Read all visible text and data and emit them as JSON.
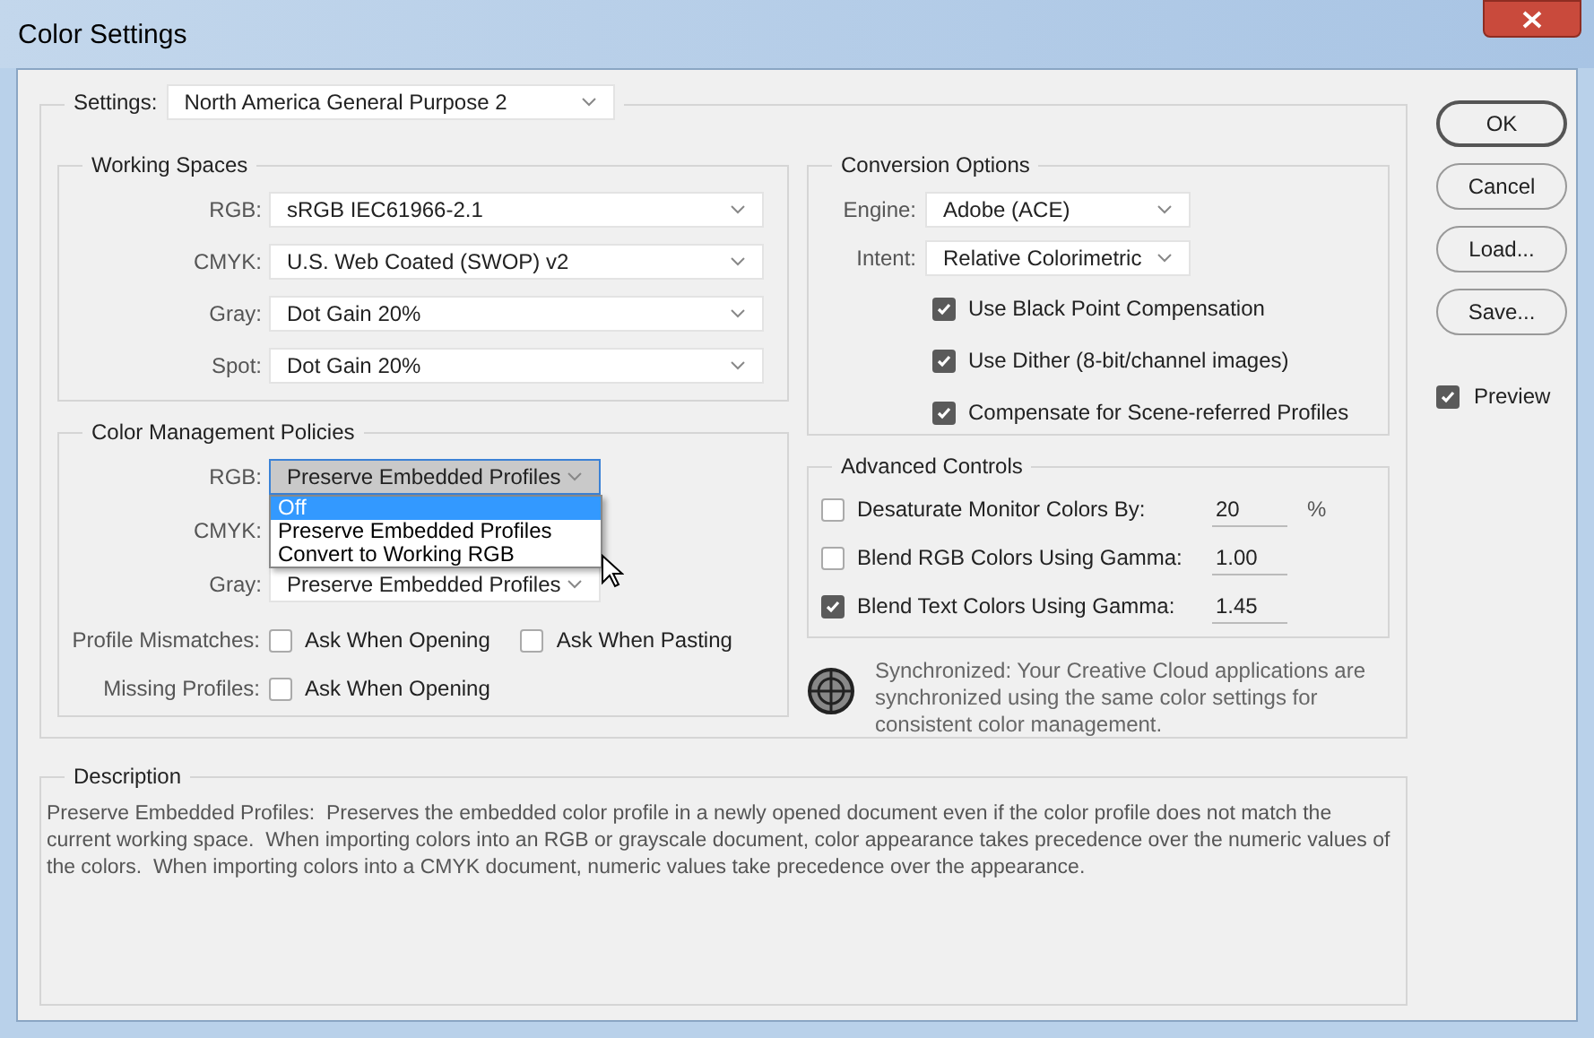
{
  "window": {
    "title": "Color Settings"
  },
  "settings": {
    "label": "Settings:",
    "value": "North America General Purpose 2"
  },
  "working_spaces": {
    "title": "Working Spaces",
    "rows": [
      {
        "label": "RGB:",
        "value": "sRGB IEC61966-2.1"
      },
      {
        "label": "CMYK:",
        "value": "U.S. Web Coated (SWOP) v2"
      },
      {
        "label": "Gray:",
        "value": "Dot Gain 20%"
      },
      {
        "label": "Spot:",
        "value": "Dot Gain 20%"
      }
    ]
  },
  "color_management_policies": {
    "title": "Color Management Policies",
    "rows": [
      {
        "label": "RGB:",
        "value": "Preserve Embedded Profiles",
        "open": true
      },
      {
        "label": "CMYK:"
      },
      {
        "label": "Gray:",
        "value": "Preserve Embedded Profiles",
        "open": false
      }
    ],
    "menu": [
      {
        "label": "Off",
        "selected": true
      },
      {
        "label": "Preserve Embedded Profiles",
        "selected": false
      },
      {
        "label": "Convert to Working RGB",
        "selected": false
      }
    ],
    "checks": [
      {
        "label": "Profile Mismatches:",
        "options": [
          {
            "label": "Ask When Opening",
            "checked": false
          },
          {
            "label": "Ask When Pasting",
            "checked": false
          }
        ]
      },
      {
        "label": "Missing Profiles:",
        "options": [
          {
            "label": "Ask When Opening",
            "checked": false
          }
        ]
      }
    ]
  },
  "conversion_options": {
    "title": "Conversion Options",
    "selects": [
      {
        "label": "Engine:",
        "value": "Adobe (ACE)"
      },
      {
        "label": "Intent:",
        "value": "Relative Colorimetric"
      }
    ],
    "checks": [
      {
        "label": "Use Black Point Compensation",
        "checked": true
      },
      {
        "label": "Use Dither (8-bit/channel images)",
        "checked": true
      },
      {
        "label": "Compensate for Scene-referred Profiles",
        "checked": true
      }
    ]
  },
  "advanced_controls": {
    "title": "Advanced Controls",
    "rows": [
      {
        "label": "Desaturate Monitor Colors By:",
        "checked": false,
        "value": "20",
        "unit": "%"
      },
      {
        "label": "Blend RGB Colors Using Gamma:",
        "checked": false,
        "value": "1.00"
      },
      {
        "label": "Blend Text Colors Using Gamma:",
        "checked": true,
        "value": "1.45"
      }
    ]
  },
  "sync_message": "Synchronized: Your Creative Cloud applications are synchronized using the same color settings for consistent color management.",
  "description": {
    "title": "Description",
    "text": "Preserve Embedded Profiles:  Preserves the embedded color profile in a newly opened document even if the color profile does not match the current working space.  When importing colors into an RGB or grayscale document, color appearance takes precedence over the numeric values of the colors.  When importing colors into a CMYK document, numeric values take precedence over the appearance."
  },
  "buttons": [
    {
      "label": "OK",
      "default": true
    },
    {
      "label": "Cancel",
      "default": false
    },
    {
      "label": "Load...",
      "default": false
    },
    {
      "label": "Save...",
      "default": false
    }
  ],
  "preview": {
    "label": "Preview",
    "checked": true
  }
}
